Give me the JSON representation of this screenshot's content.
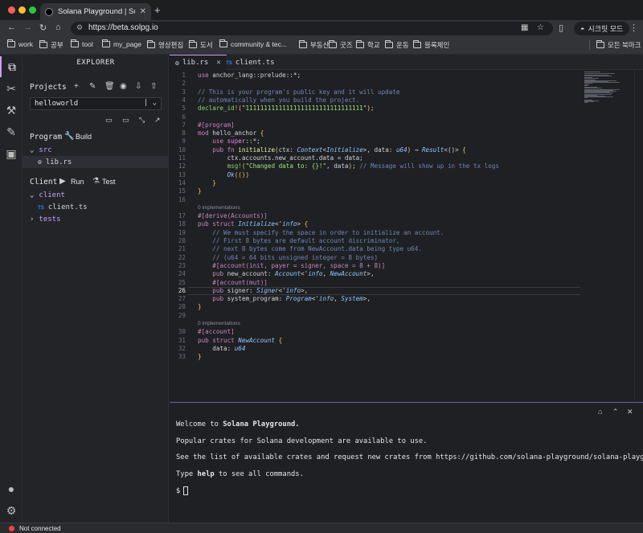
{
  "browser": {
    "tab_title": "Solana Playground | Solana IDE",
    "new_tab_label": "+",
    "url": "https://beta.solpg.io",
    "incognito_label": "시크릿 모드",
    "bookmarks": [
      "work",
      "공부",
      "tool",
      "my_page",
      "영상편집",
      "도서",
      "community & tec...",
      "부동산",
      "굿즈",
      "학교",
      "운동",
      "블록체인"
    ],
    "all_bookmarks_label": "모든 북마크",
    "colors": {
      "chrome": "#333438",
      "traffic_red": "#ff5f57",
      "traffic_yellow": "#febc2e",
      "traffic_green": "#28c840"
    }
  },
  "explorer": {
    "title": "EXPLORER",
    "projects_label": "Projects",
    "project_name": "helloworld",
    "program_label": "Program",
    "build_label": "Build",
    "src_folder": "src",
    "program_file": "lib.rs",
    "client_label": "Client",
    "run_label": "Run",
    "test_label": "Test",
    "client_folder": "client",
    "client_file": "client.ts",
    "tests_folder": "tests",
    "ts_badge": "TS"
  },
  "editor": {
    "tabs": [
      {
        "label": "lib.rs",
        "active": true
      },
      {
        "label": "client.ts",
        "active": false
      }
    ],
    "codelens": [
      "0 implementations",
      "0 implementations"
    ],
    "lines": [
      {
        "n": "1",
        "t": [
          [
            "kw",
            "use"
          ],
          [
            "nm",
            " anchor_lang::prelude::*;"
          ]
        ]
      },
      {
        "n": "2",
        "t": []
      },
      {
        "n": "3",
        "t": [
          [
            "cm",
            "// This is your program's public key and it will update"
          ]
        ]
      },
      {
        "n": "4",
        "t": [
          [
            "cm",
            "// automatically when you build the project."
          ]
        ]
      },
      {
        "n": "5",
        "t": [
          [
            "mac",
            "declare_id!"
          ],
          [
            "br",
            "("
          ],
          [
            "str",
            "\"11111111111111111111111111111111\""
          ],
          [
            "br",
            ")"
          ],
          [
            "nm",
            ";"
          ]
        ]
      },
      {
        "n": "6",
        "t": []
      },
      {
        "n": "7",
        "t": [
          [
            "attr",
            "#[program]"
          ]
        ]
      },
      {
        "n": "8",
        "t": [
          [
            "kw",
            "mod"
          ],
          [
            "nm",
            " hello_anchor "
          ],
          [
            "br",
            "{"
          ]
        ]
      },
      {
        "n": "9",
        "t": [
          [
            "nm",
            "    "
          ],
          [
            "kw",
            "use"
          ],
          [
            "kw2",
            " super"
          ],
          [
            "nm",
            "::*;"
          ]
        ]
      },
      {
        "n": "10",
        "t": [
          [
            "nm",
            "    "
          ],
          [
            "kw",
            "pub fn"
          ],
          [
            "fn",
            " initialize"
          ],
          [
            "br",
            "("
          ],
          [
            "nm",
            "ctx: "
          ],
          [
            "ty",
            "Context"
          ],
          [
            "nm",
            "<"
          ],
          [
            "ty",
            "Initialize"
          ],
          [
            "nm",
            ">, data: "
          ],
          [
            "ty",
            "u64"
          ],
          [
            "br",
            ")"
          ],
          [
            "nm",
            " → "
          ],
          [
            "ty",
            "Result"
          ],
          [
            "nm",
            "<()> "
          ],
          [
            "br",
            "{"
          ]
        ]
      },
      {
        "n": "11",
        "t": [
          [
            "nm",
            "        ctx.accounts.new_account.data = data;"
          ]
        ]
      },
      {
        "n": "12",
        "t": [
          [
            "nm",
            "        "
          ],
          [
            "mac",
            "msg!"
          ],
          [
            "br",
            "("
          ],
          [
            "str",
            "\"Changed data to: {}!\""
          ],
          [
            "nm",
            ", data"
          ],
          [
            "br",
            ")"
          ],
          [
            "nm",
            "; "
          ],
          [
            "cm",
            "// Message will show up in the tx logs"
          ]
        ]
      },
      {
        "n": "13",
        "t": [
          [
            "nm",
            "        "
          ],
          [
            "ty",
            "Ok"
          ],
          [
            "br",
            "(())"
          ]
        ]
      },
      {
        "n": "14",
        "t": [
          [
            "nm",
            "    "
          ],
          [
            "br",
            "}"
          ]
        ]
      },
      {
        "n": "15",
        "t": [
          [
            "br",
            "}"
          ]
        ]
      },
      {
        "n": "16",
        "t": []
      },
      {
        "n": "17",
        "t": [
          [
            "attr",
            "#[derive(Accounts)]"
          ]
        ]
      },
      {
        "n": "18",
        "t": [
          [
            "kw",
            "pub struct"
          ],
          [
            "ty",
            " Initialize"
          ],
          [
            "nm",
            "<'"
          ],
          [
            "ty",
            "info"
          ],
          [
            "nm",
            "> "
          ],
          [
            "br",
            "{"
          ]
        ]
      },
      {
        "n": "19",
        "t": [
          [
            "nm",
            "    "
          ],
          [
            "cm",
            "// We must specify the space in order to initialize an account."
          ]
        ]
      },
      {
        "n": "20",
        "t": [
          [
            "nm",
            "    "
          ],
          [
            "cm",
            "// First 8 bytes are default account discriminator,"
          ]
        ]
      },
      {
        "n": "21",
        "t": [
          [
            "nm",
            "    "
          ],
          [
            "cm",
            "// next 8 bytes come from NewAccount.data being type u64."
          ]
        ]
      },
      {
        "n": "22",
        "t": [
          [
            "nm",
            "    "
          ],
          [
            "cm",
            "// (u64 = 64 bits unsigned integer = 8 bytes)"
          ]
        ]
      },
      {
        "n": "23",
        "t": [
          [
            "nm",
            "    "
          ],
          [
            "attr",
            "#[account(init, payer = signer, space = 8 + 8)]"
          ]
        ]
      },
      {
        "n": "24",
        "t": [
          [
            "nm",
            "    "
          ],
          [
            "kw",
            "pub"
          ],
          [
            "nm",
            " new_account: "
          ],
          [
            "ty",
            "Account"
          ],
          [
            "nm",
            "<'"
          ],
          [
            "ty",
            "info"
          ],
          [
            "nm",
            ", "
          ],
          [
            "ty",
            "NewAccount"
          ],
          [
            "nm",
            ">,"
          ]
        ]
      },
      {
        "n": "25",
        "t": [
          [
            "nm",
            "    "
          ],
          [
            "attr",
            "#[account(mut)]"
          ]
        ]
      },
      {
        "n": "26",
        "t": [
          [
            "nm",
            "    "
          ],
          [
            "kw",
            "pub"
          ],
          [
            "nm",
            " signer: "
          ],
          [
            "ty",
            "Signer"
          ],
          [
            "nm",
            "<'"
          ],
          [
            "ty",
            "info"
          ],
          [
            "nm",
            ">,"
          ]
        ]
      },
      {
        "n": "27",
        "t": [
          [
            "nm",
            "    "
          ],
          [
            "kw",
            "pub"
          ],
          [
            "nm",
            " system_program: "
          ],
          [
            "ty",
            "Program"
          ],
          [
            "nm",
            "<'"
          ],
          [
            "ty",
            "info"
          ],
          [
            "nm",
            ", "
          ],
          [
            "ty",
            "System"
          ],
          [
            "nm",
            ">,"
          ]
        ]
      },
      {
        "n": "28",
        "t": [
          [
            "br",
            "}"
          ]
        ]
      },
      {
        "n": "29",
        "t": []
      },
      {
        "n": "30",
        "t": [
          [
            "attr",
            "#[account]"
          ]
        ]
      },
      {
        "n": "31",
        "t": [
          [
            "kw",
            "pub struct"
          ],
          [
            "ty",
            " NewAccount"
          ],
          [
            "nm",
            " "
          ],
          [
            "br",
            "{"
          ]
        ]
      },
      {
        "n": "32",
        "t": [
          [
            "nm",
            "    data: "
          ],
          [
            "ty",
            "u64"
          ]
        ]
      },
      {
        "n": "33",
        "t": [
          [
            "br",
            "}"
          ]
        ]
      }
    ],
    "active_line": "26"
  },
  "terminal": {
    "welcome_prefix": "Welcome to ",
    "welcome_name": "Solana Playground.",
    "line2": "Popular crates for Solana development are available to use.",
    "line3": "See the list of available crates and request new crates from https://github.com/solana-playground/solana-playground",
    "type_prefix": "Type ",
    "type_cmd": "help",
    "type_suffix": " to see all commands.",
    "prompt": "$"
  },
  "status": {
    "connection": "Not connected",
    "connection_color": "#ef4444"
  }
}
